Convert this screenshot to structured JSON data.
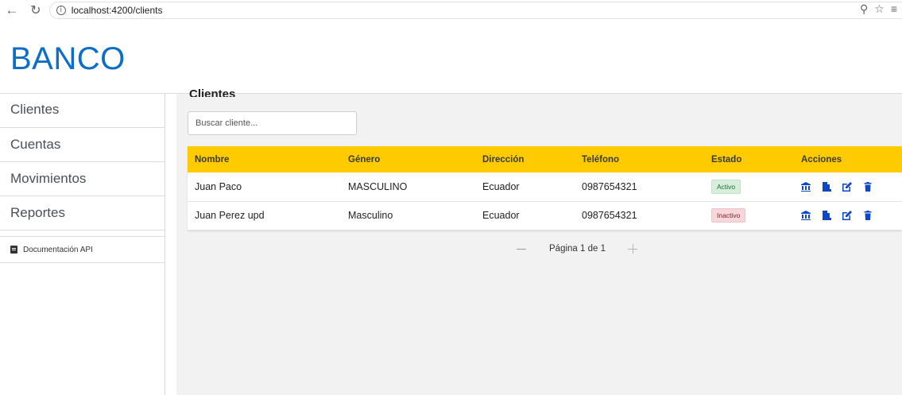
{
  "browser": {
    "url": "localhost:4200/clients"
  },
  "app": {
    "brand": "BANCO"
  },
  "sidebar": {
    "items": [
      {
        "label": "Clientes"
      },
      {
        "label": "Cuentas"
      },
      {
        "label": "Movimientos"
      },
      {
        "label": "Reportes"
      }
    ],
    "doc_link": "Documentación API"
  },
  "main": {
    "title": "Clientes",
    "search": {
      "placeholder": "Buscar cliente...",
      "value": ""
    },
    "table": {
      "headers": [
        "Nombre",
        "Género",
        "Dirección",
        "Teléfono",
        "Estado",
        "Acciones"
      ],
      "rows": [
        {
          "nombre": "Juan Paco",
          "genero": "MASCULINO",
          "direccion": "Ecuador",
          "telefono": "0987654321",
          "estado": "Activo"
        },
        {
          "nombre": "Juan Perez upd",
          "genero": "Masculino",
          "direccion": "Ecuador",
          "telefono": "0987654321",
          "estado": "Inactivo"
        }
      ],
      "row_actions": [
        "bank-icon",
        "file-icon",
        "edit-icon",
        "trash-icon"
      ]
    },
    "pagination": {
      "label": "Página 1 de 1"
    }
  },
  "colors": {
    "brand": "#0d6ec8",
    "table_header": "#fecb00",
    "action_icon": "#0d47c9",
    "active_badge": "#d6efdb",
    "inactive_badge": "#f7d7da"
  }
}
